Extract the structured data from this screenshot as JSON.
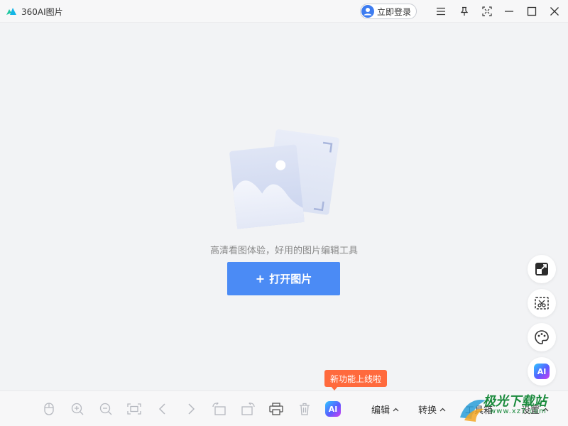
{
  "titlebar": {
    "app_title": "360AI图片",
    "login_label": "立即登录",
    "icons": [
      "app-logo",
      "user-avatar-icon",
      "menu-icon",
      "pin-icon",
      "fullscreen-icon",
      "minimize-icon",
      "maximize-icon",
      "close-icon"
    ]
  },
  "main": {
    "tagline": "高清看图体验，好用的图片编辑工具",
    "open_button_plus": "+",
    "open_button_label": "打开图片"
  },
  "float_tools": {
    "ai_label": "AI",
    "icons": [
      "expand-icon",
      "crop-cut-icon",
      "palette-icon",
      "ai-icon"
    ]
  },
  "toolbar": {
    "tooltip": "新功能上线啦",
    "ai_label": "AI",
    "menus": [
      "编辑",
      "转换",
      "工具箱",
      "设置"
    ],
    "icons": [
      "mouse-icon",
      "zoom-in-icon",
      "zoom-out-icon",
      "fit-screen-icon",
      "previous-icon",
      "next-icon",
      "rotate-left-icon",
      "rotate-right-icon",
      "print-icon",
      "delete-icon",
      "ai-icon"
    ]
  },
  "watermark": {
    "title": "极光下载站",
    "sub": "www.xz7.com"
  },
  "colors": {
    "accent": "#4b8bf5",
    "tooltip": "#ff6a3d",
    "background": "#f2f3f5"
  }
}
